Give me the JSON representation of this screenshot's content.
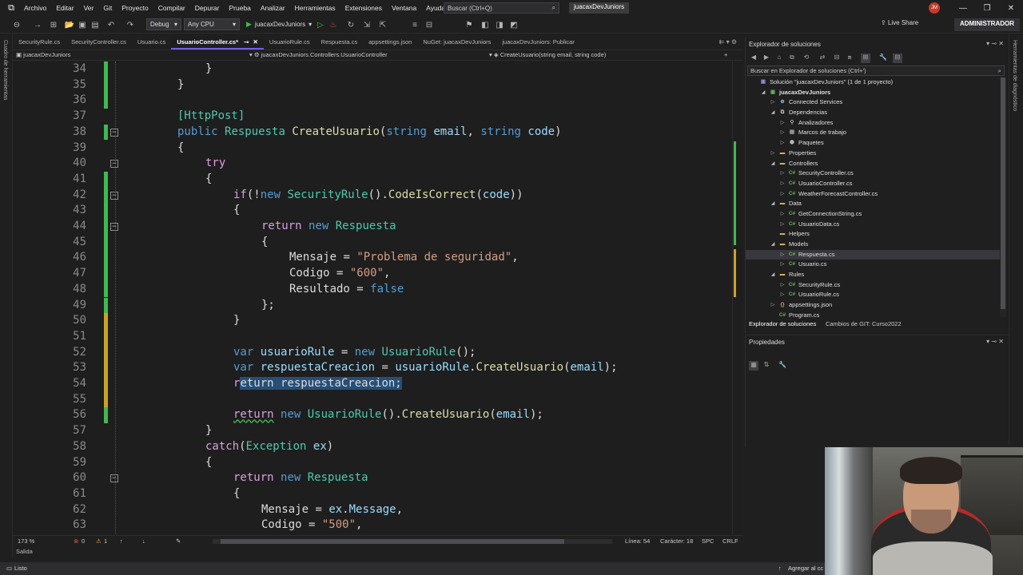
{
  "menubar": {
    "items": [
      "Archivo",
      "Editar",
      "Ver",
      "Git",
      "Proyecto",
      "Compilar",
      "Depurar",
      "Prueba",
      "Analizar",
      "Herramientas",
      "Extensiones",
      "Ventana",
      "Ayuda"
    ],
    "search_placeholder": "Buscar (Ctrl+Q)",
    "solution_name": "juacaxDevJuniors",
    "avatar_initials": "JM"
  },
  "toolbar": {
    "config": "Debug",
    "platform": "Any CPU",
    "run_target": "juacaxDevJuniors",
    "live_share": "Live Share",
    "admin": "ADMINISTRADOR"
  },
  "left_strip": {
    "label": "Cuadro de herramientas"
  },
  "right_strip": {
    "label": "Herramientas de diagnóstico"
  },
  "tabs": [
    {
      "label": "SecurityRule.cs",
      "active": false
    },
    {
      "label": "SecurityController.cs",
      "active": false
    },
    {
      "label": "Usuario.cs",
      "active": false
    },
    {
      "label": "UsuarioController.cs*",
      "active": true
    },
    {
      "label": "UsuarioRule.cs",
      "active": false
    },
    {
      "label": "Respuesta.cs",
      "active": false
    },
    {
      "label": "appsettings.json",
      "active": false
    },
    {
      "label": "NuGet: juacaxDevJuniors",
      "active": false
    },
    {
      "label": "juacaxDevJuniors: Publicar",
      "active": false
    }
  ],
  "navbar": {
    "project": "juacaxDevJuniors",
    "class": "juacaxDevJuniors.Controllers.UsuarioController",
    "member": "CreateUsuario(string email, string code)"
  },
  "code_lines": [
    {
      "n": "34"
    },
    {
      "n": "35"
    },
    {
      "n": "36"
    },
    {
      "n": "37"
    },
    {
      "n": "38"
    },
    {
      "n": "39"
    },
    {
      "n": "40"
    },
    {
      "n": "41"
    },
    {
      "n": "42"
    },
    {
      "n": "43"
    },
    {
      "n": "44"
    },
    {
      "n": "45"
    },
    {
      "n": "46"
    },
    {
      "n": "47"
    },
    {
      "n": "48"
    },
    {
      "n": "49"
    },
    {
      "n": "50"
    },
    {
      "n": "51"
    },
    {
      "n": "52"
    },
    {
      "n": "53"
    },
    {
      "n": "54"
    },
    {
      "n": "55"
    },
    {
      "n": "56"
    },
    {
      "n": "57"
    },
    {
      "n": "58"
    },
    {
      "n": "59"
    },
    {
      "n": "60"
    },
    {
      "n": "61"
    },
    {
      "n": "62"
    },
    {
      "n": "63"
    }
  ],
  "code_text": {
    "l34": "}",
    "l35": "}",
    "l37": "[HttpPost]",
    "l38_public": "public",
    "l38_type": "Respuesta",
    "l38_method": "CreateUsuario",
    "l38_params_open": "(",
    "l38_string1": "string",
    "l38_email": "email",
    "l38_comma": ",",
    "l38_string2": "string",
    "l38_code": "code",
    "l38_close": ")",
    "l39": "{",
    "l40": "try",
    "l41": "{",
    "l42_if": "if",
    "l42_not": "(!",
    "l42_new": "new",
    "l42_type": "SecurityRule",
    "l42_call": "().",
    "l42_method": "CodeIsCorrect",
    "l42_open": "(",
    "l42_arg": "code",
    "l42_close": "))",
    "l43": "{",
    "l44_return": "return",
    "l44_new": "new",
    "l44_type": "Respuesta",
    "l45": "{",
    "l46_prop": "Mensaje",
    "l46_eq": " = ",
    "l46_str": "\"Problema de seguridad\"",
    "l46_comma": ",",
    "l47_prop": "Codigo",
    "l47_eq": " = ",
    "l47_str": "\"600\"",
    "l47_comma": ",",
    "l48_prop": "Resultado",
    "l48_eq": " = ",
    "l48_val": "false",
    "l49": "};",
    "l50": "}",
    "l52_var": "var",
    "l52_name": "usuarioRule",
    "l52_eq": " = ",
    "l52_new": "new",
    "l52_type": "UsuarioRule",
    "l52_end": "();",
    "l53_var": "var",
    "l53_name": "respuestaCreacion",
    "l53_eq": " = ",
    "l53_obj": "usuarioRule",
    "l53_dot": ".",
    "l53_method": "CreateUsuario",
    "l53_open": "(",
    "l53_arg": "email",
    "l53_end": ");",
    "l54_r": "r",
    "l54_sel": "eturn respuestaCreacion;",
    "l56_return": "return",
    "l56_new": "new",
    "l56_type": "UsuarioRule",
    "l56_call": "().",
    "l56_method": "CreateUsuario",
    "l56_open": "(",
    "l56_arg": "email",
    "l56_end": ");",
    "l57": "}",
    "l58_catch": "catch",
    "l58_open": "(",
    "l58_type": "Exception",
    "l58_ex": "ex",
    "l58_close": ")",
    "l59": "{",
    "l60_return": "return",
    "l60_new": "new",
    "l60_type": "Respuesta",
    "l61": "{",
    "l62_prop": "Mensaje",
    "l62_eq": " = ",
    "l62_obj": "ex",
    "l62_dot": ".",
    "l62_member": "Message",
    "l62_comma": ",",
    "l63_prop": "Codigo",
    "l63_eq": " = ",
    "l63_str": "\"500\"",
    "l63_comma": ","
  },
  "editor_status": {
    "zoom": "173 %",
    "errors": "0",
    "warnings": "1",
    "line": "Línea: 54",
    "char": "Carácter: 18",
    "spc": "SPC",
    "crlf": "CRLF"
  },
  "output_tab": "Salida",
  "statusbar": {
    "left": "Listo",
    "right": "Agregar al cc"
  },
  "solution_explorer": {
    "title": "Explorador de soluciones",
    "search_placeholder": "Buscar en Explorador de soluciones (Ctrl+')",
    "tree": [
      {
        "label": "Solución \"juacaxDevJuniors\" (1 de 1 proyecto)",
        "icon": "solution-icon",
        "indent": 0,
        "twisty": ""
      },
      {
        "label": "juacaxDevJuniors",
        "icon": "project-icon",
        "indent": 1,
        "twisty": "expanded",
        "bold": true
      },
      {
        "label": "Connected Services",
        "icon": "connected-services-icon",
        "indent": 2,
        "twisty": "collapsed"
      },
      {
        "label": "Dependencias",
        "icon": "dependencies-icon",
        "indent": 2,
        "twisty": "expanded"
      },
      {
        "label": "Analizadores",
        "icon": "analyzers-icon",
        "indent": 3,
        "twisty": "collapsed"
      },
      {
        "label": "Marcos de trabajo",
        "icon": "frameworks-icon",
        "indent": 3,
        "twisty": "collapsed"
      },
      {
        "label": "Paquetes",
        "icon": "packages-icon",
        "indent": 3,
        "twisty": "collapsed"
      },
      {
        "label": "Properties",
        "icon": "folder-icon",
        "indent": 2,
        "twisty": "collapsed"
      },
      {
        "label": "Controllers",
        "icon": "folder-icon",
        "indent": 2,
        "twisty": "expanded"
      },
      {
        "label": "SecurityController.cs",
        "icon": "csharp-file-icon",
        "indent": 3,
        "twisty": "collapsed"
      },
      {
        "label": "UsuarioController.cs",
        "icon": "csharp-file-icon",
        "indent": 3,
        "twisty": "collapsed"
      },
      {
        "label": "WeatherForecastController.cs",
        "icon": "csharp-file-icon",
        "indent": 3,
        "twisty": "collapsed"
      },
      {
        "label": "Data",
        "icon": "folder-icon",
        "indent": 2,
        "twisty": "expanded"
      },
      {
        "label": "GetConnectionString.cs",
        "icon": "csharp-file-icon",
        "indent": 3,
        "twisty": "collapsed"
      },
      {
        "label": "UsuarioData.cs",
        "icon": "csharp-file-icon",
        "indent": 3,
        "twisty": "collapsed"
      },
      {
        "label": "Helpers",
        "icon": "folder-icon",
        "indent": 2,
        "twisty": ""
      },
      {
        "label": "Models",
        "icon": "folder-icon",
        "indent": 2,
        "twisty": "expanded"
      },
      {
        "label": "Respuesta.cs",
        "icon": "csharp-file-icon",
        "indent": 3,
        "twisty": "collapsed",
        "selected": true
      },
      {
        "label": "Usuario.cs",
        "icon": "csharp-file-icon",
        "indent": 3,
        "twisty": "collapsed"
      },
      {
        "label": "Rules",
        "icon": "folder-icon",
        "indent": 2,
        "twisty": "expanded"
      },
      {
        "label": "SecurityRule.cs",
        "icon": "csharp-file-icon",
        "indent": 3,
        "twisty": "collapsed"
      },
      {
        "label": "UsuarioRule.cs",
        "icon": "csharp-file-icon",
        "indent": 3,
        "twisty": "collapsed"
      },
      {
        "label": "appsettings.json",
        "icon": "json-file-icon",
        "indent": 2,
        "twisty": "collapsed"
      },
      {
        "label": "Program.cs",
        "icon": "csharp-file-icon",
        "indent": 2,
        "twisty": ""
      }
    ],
    "bottom_tabs": [
      "Explorador de soluciones",
      "Cambios de GIT: Curso2022"
    ]
  },
  "properties": {
    "title": "Propiedades"
  },
  "colors": {
    "accent": "#7160e8",
    "change_saved": "#3fb950",
    "change_unsaved": "#c9a227",
    "keyword": "#569cd6",
    "control_keyword": "#d8a0df",
    "type": "#4ec9b0",
    "method": "#dcdcaa",
    "string": "#d69d85",
    "variable": "#9cdcfe",
    "selection": "#264f78"
  }
}
